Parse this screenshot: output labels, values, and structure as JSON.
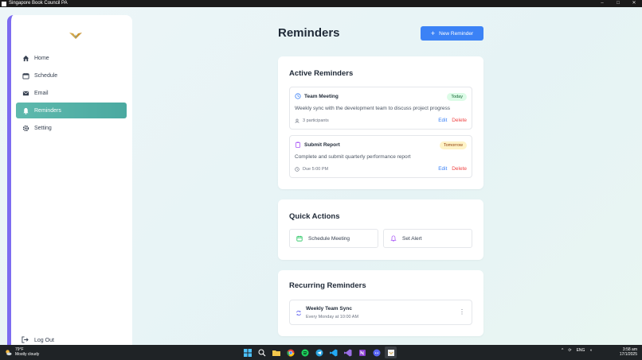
{
  "window": {
    "title": "Singapore Book Council PA",
    "controls": [
      "–",
      "□",
      "✕"
    ]
  },
  "sidebar": {
    "items": [
      {
        "label": "Home",
        "icon": "home-icon"
      },
      {
        "label": "Schedule",
        "icon": "calendar-icon"
      },
      {
        "label": "Email",
        "icon": "mail-icon"
      },
      {
        "label": "Reminders",
        "icon": "bell-icon",
        "active": true
      },
      {
        "label": "Setting",
        "icon": "gear-icon"
      }
    ],
    "logout_label": "Log Out"
  },
  "header": {
    "title": "Reminders",
    "new_button_label": "New Reminder"
  },
  "active_reminders": {
    "title": "Active Reminders",
    "items": [
      {
        "title": "Team Meeting",
        "badge": "Today",
        "description": "Weekly sync with the development team to discuss project progress",
        "meta": "3 participants",
        "edit_label": "Edit",
        "delete_label": "Delete"
      },
      {
        "title": "Submit Report",
        "badge": "Tomorrow",
        "description": "Complete and submit quarterly performance report",
        "meta": "Due 5:00 PM",
        "edit_label": "Edit",
        "delete_label": "Delete"
      }
    ]
  },
  "quick_actions": {
    "title": "Quick Actions",
    "schedule_label": "Schedule Meeting",
    "alert_label": "Set Alert"
  },
  "recurring": {
    "title": "Recurring Reminders",
    "item_title": "Weekly Team Sync",
    "item_subtitle": "Every Monday at 10:00 AM"
  },
  "taskbar": {
    "temperature": "79°F",
    "weather": "Mostly cloudy",
    "language": "ENG",
    "time": "3:58 am",
    "date": "17/1/2025"
  },
  "colors": {
    "accent": "#3b82f6",
    "active_nav": "#52b1a6",
    "sidebar_border": "#7c6cf0"
  }
}
